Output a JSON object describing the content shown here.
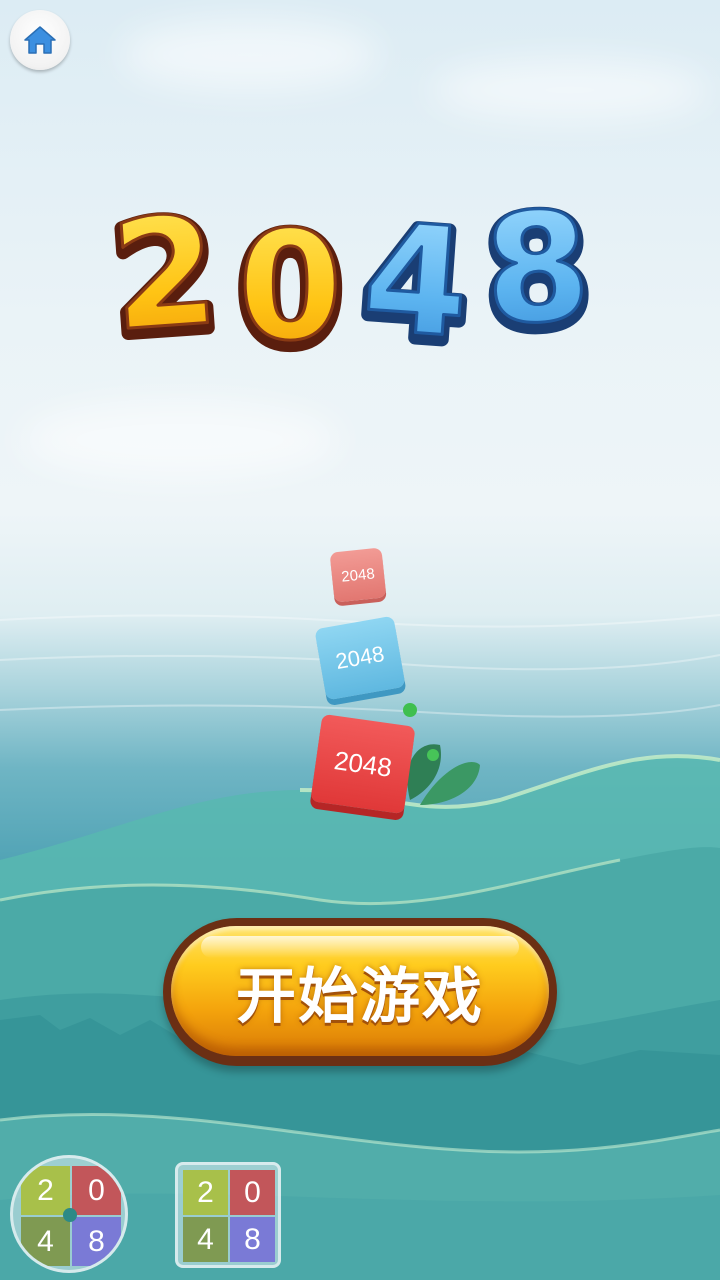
{
  "logo": {
    "digits": [
      "2",
      "0",
      "4",
      "8"
    ]
  },
  "home": {
    "icon": "home-icon"
  },
  "start_button": {
    "label": "开始游戏"
  },
  "falling_tiles": [
    {
      "label": "2048",
      "color": "#e88a85"
    },
    {
      "label": "2048",
      "color": "#6ec4e6"
    },
    {
      "label": "2048",
      "color": "#ec4646"
    }
  ],
  "modes": [
    {
      "cells": [
        "2",
        "0",
        "4",
        "8"
      ],
      "shape": "circle"
    },
    {
      "cells": [
        "2",
        "0",
        "4",
        "8"
      ],
      "shape": "square"
    }
  ],
  "colors": {
    "logo_gold": "#ffc91c",
    "logo_blue": "#5ab1ee",
    "button_gold": "#f6b412",
    "tile_red": "#ec4646",
    "tile_blue": "#6ec4e6",
    "tile_pink": "#e88a85"
  }
}
